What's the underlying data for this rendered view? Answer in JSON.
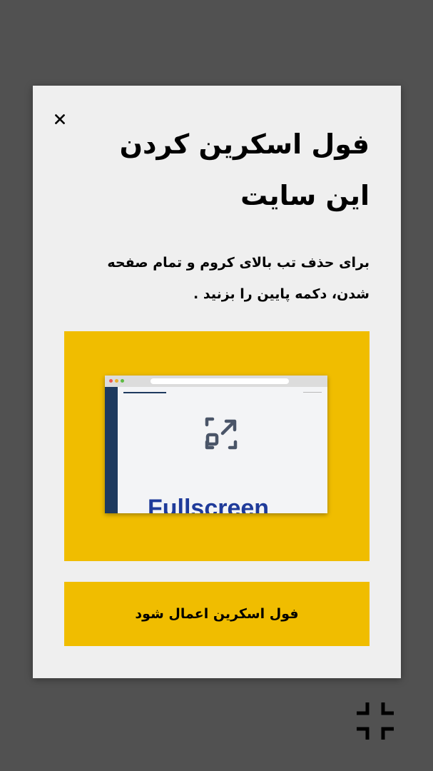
{
  "modal": {
    "close_symbol": "×",
    "title": "فول اسکرین کردن این سایت",
    "description": "برای حذف تب بالای کروم و تمام صفحه شدن، دکمه پایین را بزنید .",
    "preview": {
      "browser_text": "Fullscreen",
      "icon": "expand-arrow-icon"
    },
    "apply_button_label": "فول اسکرین اعمال شود"
  },
  "floating": {
    "icon": "exit-fullscreen-icon"
  },
  "colors": {
    "backdrop": "#515151",
    "modal_bg": "#efefef",
    "accent": "#f0bd00",
    "preview_sidebar": "#1e3a5f",
    "preview_text": "#1f3b9a"
  }
}
